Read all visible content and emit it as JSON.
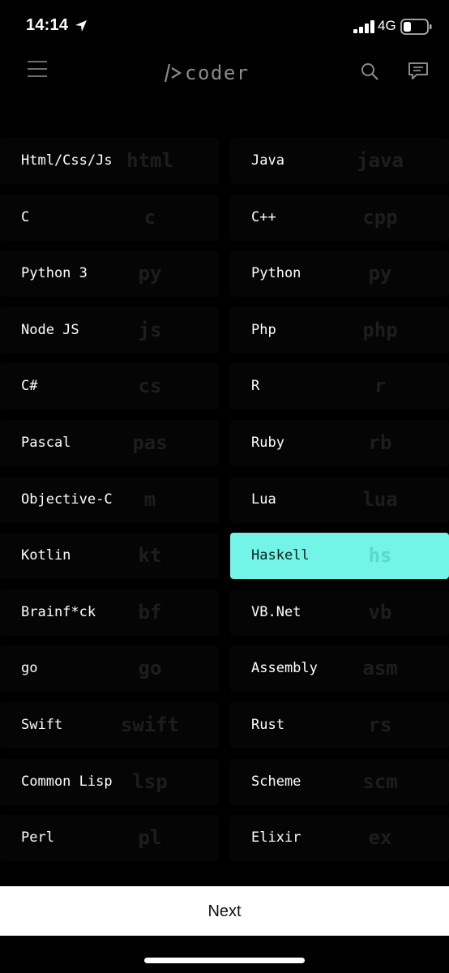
{
  "status_bar": {
    "time": "14:14",
    "network": "4G",
    "icons": [
      "location-arrow-icon",
      "signal-icon",
      "battery-icon"
    ]
  },
  "header": {
    "logo_text": "coder",
    "icons": [
      "menu-icon",
      "search-icon",
      "chat-icon"
    ]
  },
  "languages": [
    {
      "name": "Html/Css/Js",
      "ext": "html",
      "selected": false
    },
    {
      "name": "Java",
      "ext": "java",
      "selected": false
    },
    {
      "name": "C",
      "ext": "c",
      "selected": false
    },
    {
      "name": "C++",
      "ext": "cpp",
      "selected": false
    },
    {
      "name": "Python 3",
      "ext": "py",
      "selected": false
    },
    {
      "name": "Python",
      "ext": "py",
      "selected": false
    },
    {
      "name": "Node JS",
      "ext": "js",
      "selected": false
    },
    {
      "name": "Php",
      "ext": "php",
      "selected": false
    },
    {
      "name": "C#",
      "ext": "cs",
      "selected": false
    },
    {
      "name": "R",
      "ext": "r",
      "selected": false
    },
    {
      "name": "Pascal",
      "ext": "pas",
      "selected": false
    },
    {
      "name": "Ruby",
      "ext": "rb",
      "selected": false
    },
    {
      "name": "Objective-C",
      "ext": "m",
      "selected": false
    },
    {
      "name": "Lua",
      "ext": "lua",
      "selected": false
    },
    {
      "name": "Kotlin",
      "ext": "kt",
      "selected": false
    },
    {
      "name": "Haskell",
      "ext": "hs",
      "selected": true
    },
    {
      "name": "Brainf*ck",
      "ext": "bf",
      "selected": false
    },
    {
      "name": "VB.Net",
      "ext": "vb",
      "selected": false
    },
    {
      "name": "go",
      "ext": "go",
      "selected": false
    },
    {
      "name": "Assembly",
      "ext": "asm",
      "selected": false
    },
    {
      "name": "Swift",
      "ext": "swift",
      "selected": false
    },
    {
      "name": "Rust",
      "ext": "rs",
      "selected": false
    },
    {
      "name": "Common Lisp",
      "ext": "lsp",
      "selected": false
    },
    {
      "name": "Scheme",
      "ext": "scm",
      "selected": false
    },
    {
      "name": "Perl",
      "ext": "pl",
      "selected": false
    },
    {
      "name": "Elixir",
      "ext": "ex",
      "selected": false
    }
  ],
  "footer": {
    "next_label": "Next"
  },
  "colors": {
    "background": "#000000",
    "selected_tile": "#72f5e6",
    "extension_text": "#1d1d1d",
    "logo_gray": "#8a8a8a"
  }
}
